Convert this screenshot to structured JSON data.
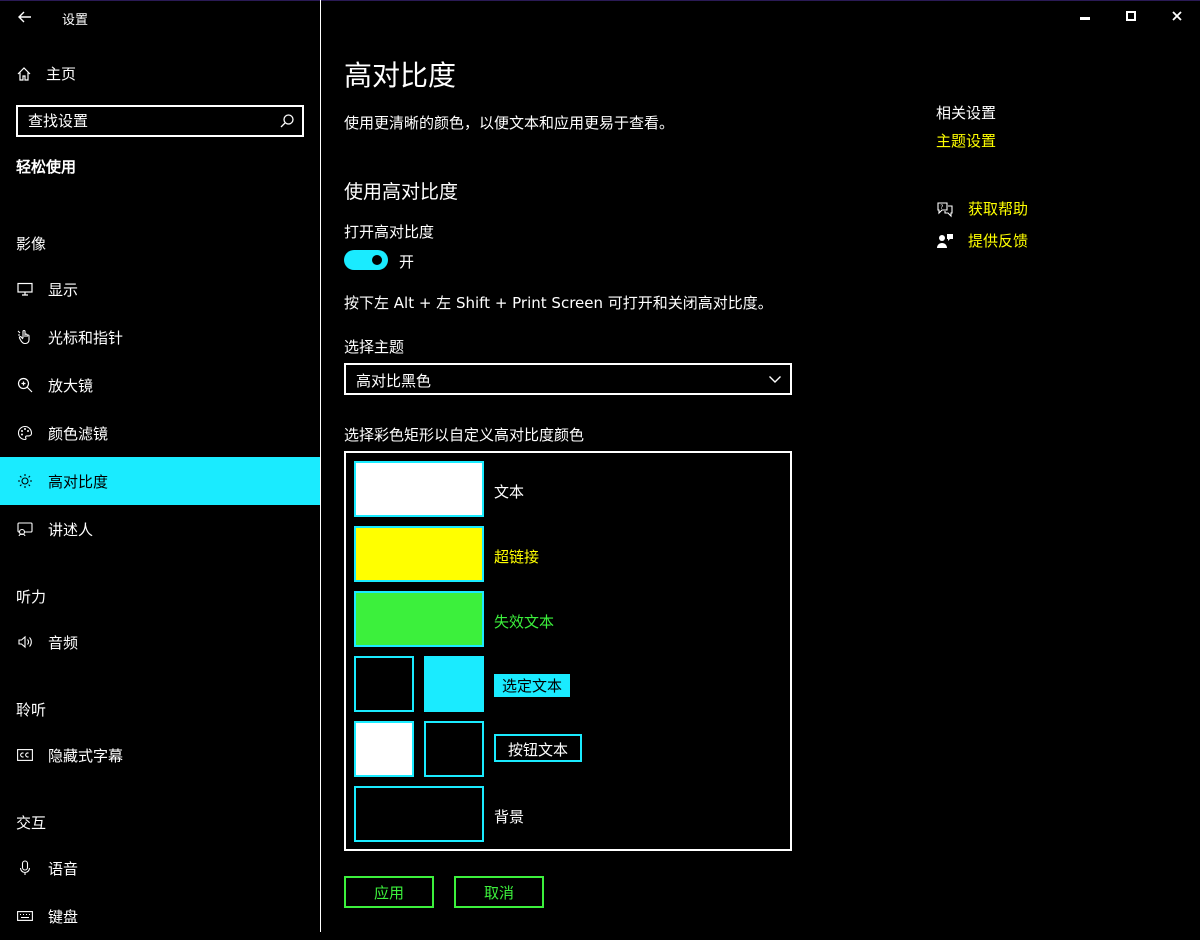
{
  "app": {
    "title": "设置"
  },
  "sidebar": {
    "home_label": "主页",
    "search_placeholder": "查找设置",
    "category": "轻松使用",
    "groups": {
      "vision": "影像",
      "hearing": "听力",
      "listening": "聆听",
      "interaction": "交互"
    },
    "items": {
      "display": "显示",
      "cursor": "光标和指针",
      "magnifier": "放大镜",
      "color_filters": "颜色滤镜",
      "high_contrast": "高对比度",
      "narrator": "讲述人",
      "audio": "音频",
      "captions": "隐藏式字幕",
      "speech": "语音",
      "keyboard": "键盘"
    }
  },
  "main": {
    "title": "高对比度",
    "description": "使用更清晰的颜色，以便文本和应用更易于查看。",
    "section_title": "使用高对比度",
    "toggle_label": "打开高对比度",
    "toggle_state": "开",
    "shortcut_text": "按下左 Alt + 左 Shift + Print Screen 可打开和关闭高对比度。",
    "theme_label": "选择主题",
    "theme_value": "高对比黑色",
    "colors_label": "选择彩色矩形以自定义高对比度颜色",
    "swatches": {
      "text": "文本",
      "hyperlink": "超链接",
      "disabled_text": "失效文本",
      "selected_text": "选定文本",
      "button_text": "按钮文本",
      "background": "背景"
    },
    "apply_label": "应用",
    "cancel_label": "取消"
  },
  "related": {
    "title": "相关设置",
    "theme_link": "主题设置",
    "get_help": "获取帮助",
    "feedback": "提供反馈"
  },
  "colors": {
    "accent": "#1aebff",
    "hyperlink": "#ffff00",
    "disabled": "#3cf03c",
    "text": "#ffffff",
    "background": "#000000"
  },
  "icons": [
    "back-arrow-icon",
    "home-icon",
    "search-icon",
    "monitor-icon",
    "cursor-hand-icon",
    "magnifier-icon",
    "palette-icon",
    "sun-icon",
    "narrator-icon",
    "speaker-icon",
    "cc-icon",
    "microphone-icon",
    "keyboard-icon",
    "minimize-icon",
    "maximize-icon",
    "close-icon",
    "chevron-down-icon",
    "help-chat-icon",
    "feedback-icon"
  ]
}
